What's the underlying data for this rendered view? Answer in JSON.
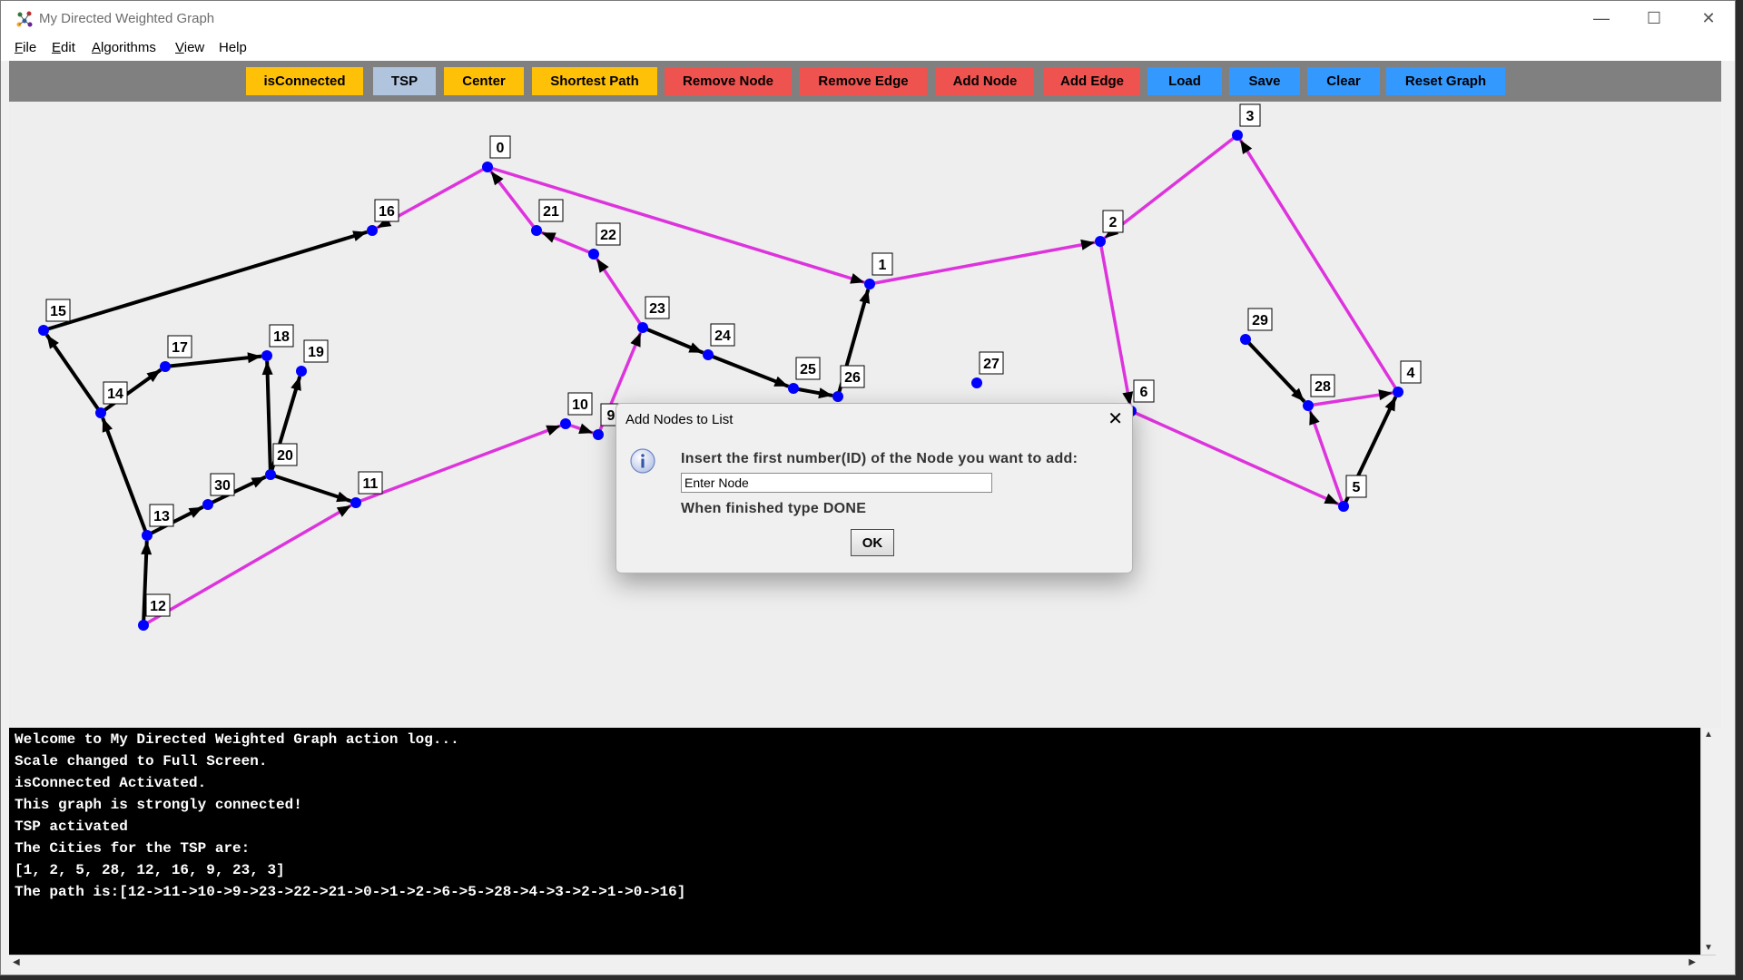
{
  "window": {
    "title": "My Directed Weighted Graph",
    "minimize_icon": "minimize-icon",
    "maximize_icon": "maximize-icon",
    "close_icon": "close-icon"
  },
  "menu": {
    "file": {
      "mnemonic": "F",
      "rest": "ile"
    },
    "edit": {
      "mnemonic": "E",
      "rest": "dit"
    },
    "algorithms": {
      "mnemonic": "A",
      "rest": "lgorithms"
    },
    "view": {
      "mnemonic": "V",
      "rest": "iew"
    },
    "help": "Help"
  },
  "toolbar": {
    "buttons": [
      {
        "label": "isConnected",
        "color": "#ffc107"
      },
      {
        "label": "TSP",
        "color": "#b0c4de"
      },
      {
        "label": "Center",
        "color": "#ffc107"
      },
      {
        "label": "Shortest Path",
        "color": "#ffc107"
      },
      {
        "label": "Remove Node",
        "color": "#ef5350"
      },
      {
        "label": "Remove Edge",
        "color": "#ef5350"
      },
      {
        "label": "Add Node",
        "color": "#ef5350"
      },
      {
        "label": "Add Edge",
        "color": "#ef5350"
      },
      {
        "label": "Load",
        "color": "#3399ff"
      },
      {
        "label": "Save",
        "color": "#3399ff"
      },
      {
        "label": "Clear",
        "color": "#3399ff"
      },
      {
        "label": "Reset Graph",
        "color": "#3399ff"
      }
    ]
  },
  "graph": {
    "colors": {
      "node": "#0000ff",
      "edge": "#000000",
      "path": "#dd33dd",
      "label_bg": "#ffffff"
    },
    "nodes": [
      {
        "id": "0"
      },
      {
        "id": "1"
      },
      {
        "id": "2"
      },
      {
        "id": "3"
      },
      {
        "id": "4"
      },
      {
        "id": "5"
      },
      {
        "id": "6"
      },
      {
        "id": "9"
      },
      {
        "id": "10"
      },
      {
        "id": "11"
      },
      {
        "id": "12"
      },
      {
        "id": "13"
      },
      {
        "id": "14"
      },
      {
        "id": "15"
      },
      {
        "id": "16"
      },
      {
        "id": "17"
      },
      {
        "id": "18"
      },
      {
        "id": "19"
      },
      {
        "id": "20"
      },
      {
        "id": "21"
      },
      {
        "id": "22"
      },
      {
        "id": "23"
      },
      {
        "id": "24"
      },
      {
        "id": "25"
      },
      {
        "id": "26"
      },
      {
        "id": "27"
      },
      {
        "id": "28"
      },
      {
        "id": "29"
      },
      {
        "id": "30"
      }
    ],
    "edges": [
      [
        "12",
        "13"
      ],
      [
        "13",
        "14"
      ],
      [
        "14",
        "15"
      ],
      [
        "15",
        "16"
      ],
      [
        "14",
        "17"
      ],
      [
        "17",
        "18"
      ],
      [
        "20",
        "18"
      ],
      [
        "20",
        "19"
      ],
      [
        "13",
        "30"
      ],
      [
        "30",
        "20"
      ],
      [
        "20",
        "11"
      ],
      [
        "23",
        "24"
      ],
      [
        "24",
        "25"
      ],
      [
        "25",
        "26"
      ],
      [
        "26",
        "1"
      ],
      [
        "29",
        "28"
      ],
      [
        "5",
        "4"
      ]
    ],
    "path_edges": [
      [
        "12",
        "11"
      ],
      [
        "11",
        "10"
      ],
      [
        "10",
        "9"
      ],
      [
        "9",
        "23"
      ],
      [
        "23",
        "22"
      ],
      [
        "22",
        "21"
      ],
      [
        "21",
        "0"
      ],
      [
        "0",
        "1"
      ],
      [
        "1",
        "2"
      ],
      [
        "2",
        "6"
      ],
      [
        "6",
        "5"
      ],
      [
        "5",
        "28"
      ],
      [
        "28",
        "4"
      ],
      [
        "4",
        "3"
      ],
      [
        "3",
        "2"
      ],
      [
        "0",
        "16"
      ]
    ]
  },
  "dialog": {
    "title": "Add Nodes to List",
    "icon": "info-icon",
    "prompt": "Insert the first number(ID) of the Node you want to add:",
    "input_value": "Enter Node",
    "hint": "When finished type DONE",
    "ok_label": "OK"
  },
  "log": {
    "lines": [
      "Welcome to My Directed Weighted Graph action log...",
      "Scale changed to Full Screen.",
      "isConnected Activated.",
      "This graph is strongly connected!",
      "TSP activated",
      "The Cities for the TSP are:",
      "[1, 2, 5, 28, 12, 16, 9, 23, 3]",
      "The path is:[12->11->10->9->23->22->21->0->1->2->6->5->28->4->3->2->1->0->16]"
    ]
  }
}
